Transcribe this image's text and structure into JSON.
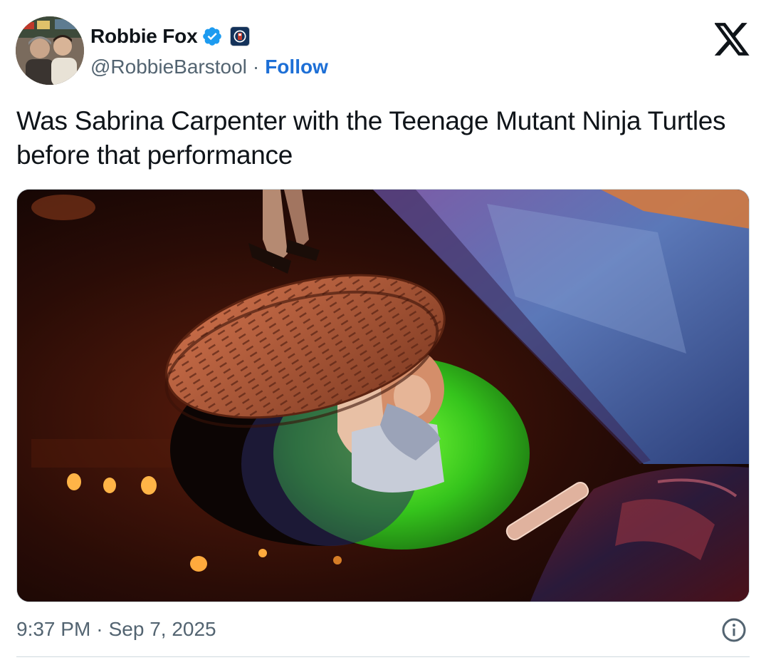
{
  "author": {
    "display_name": "Robbie Fox",
    "handle": "@RobbieBarstool",
    "separator": "·",
    "follow_label": "Follow",
    "verified": true
  },
  "post": {
    "text": "Was Sabrina Carpenter with the Teenage Mutant Ninja Turtles before that performance",
    "time": "9:37 PM",
    "separator": "·",
    "date": "Sep 7, 2025"
  },
  "icons": {
    "verified": "verified-badge-icon",
    "affiliate": "barstool-affiliate-badge",
    "brand": "x-logo-icon",
    "info": "info-icon"
  },
  "colors": {
    "accent": "#1d9bf0",
    "link": "#1d6fd6",
    "muted": "#536471",
    "text": "#0f1419",
    "border": "#cfd9de"
  }
}
